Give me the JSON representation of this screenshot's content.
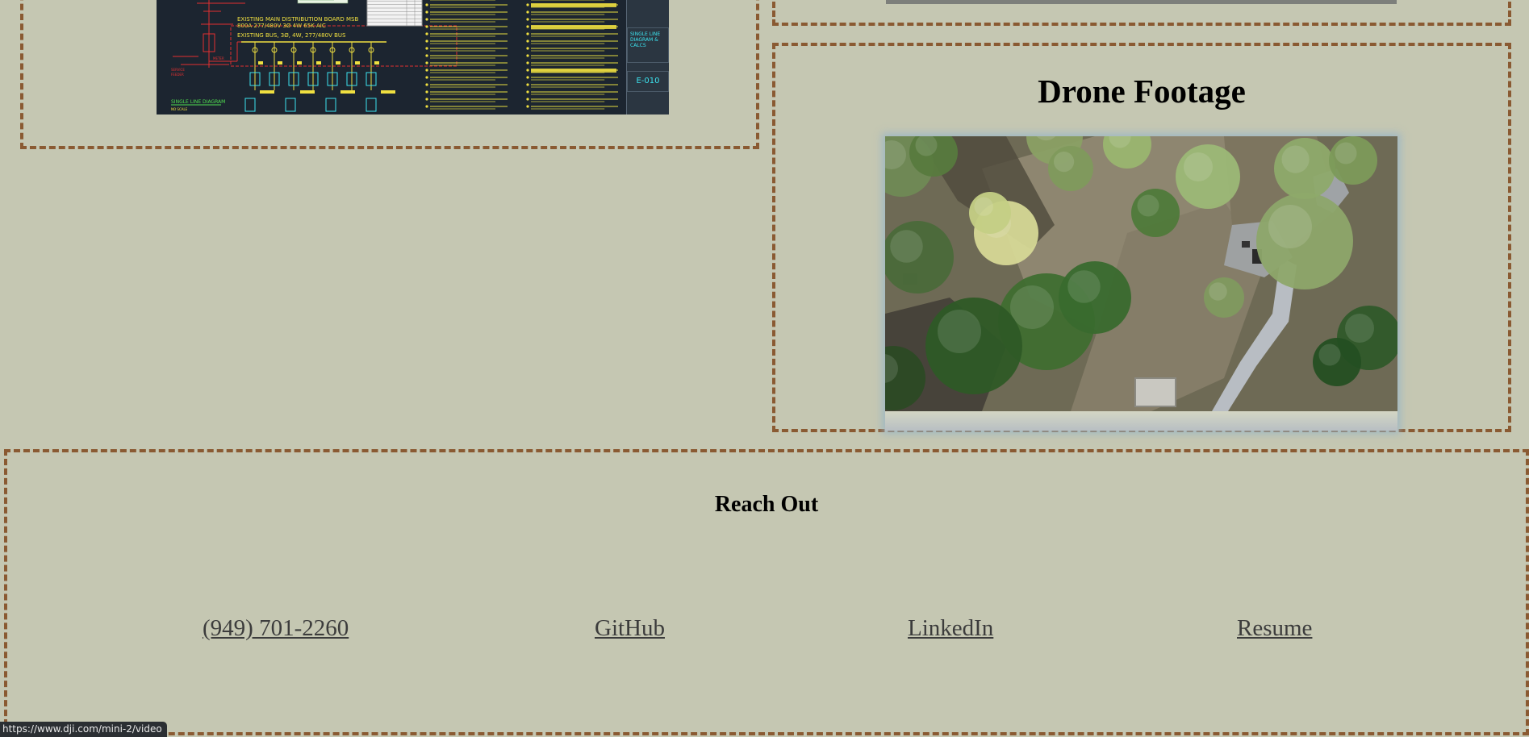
{
  "cad_drawing": {
    "board_label": "EXISTING MAIN DISTRIBUTION BOARD MSB",
    "board_rating": "800A  277/480V  3Ø  4W  65K AIC",
    "bus_label": "EXISTING BUS, 3Ø, 4W, 277/480V BUS",
    "diagram_label": "SINGLE LINE DIAGRAM",
    "diagram_scale": "NO SCALE",
    "sheet_title": "SINGLE LINE DIAGRAM & CALCS",
    "sheet_number": "E-010"
  },
  "drone": {
    "title": "Drone Footage",
    "video_label": "aerial drone video"
  },
  "contact": {
    "title": "Reach Out",
    "links": [
      "(949) 701-2260",
      "GitHub",
      "LinkedIn",
      "Resume"
    ]
  },
  "status_bar": {
    "url": "https://www.dji.com/mini-2/video"
  },
  "colors": {
    "page_background": "#c5c7b2",
    "panel_border": "#8a5a32",
    "link_text": "#3c3c3c"
  }
}
